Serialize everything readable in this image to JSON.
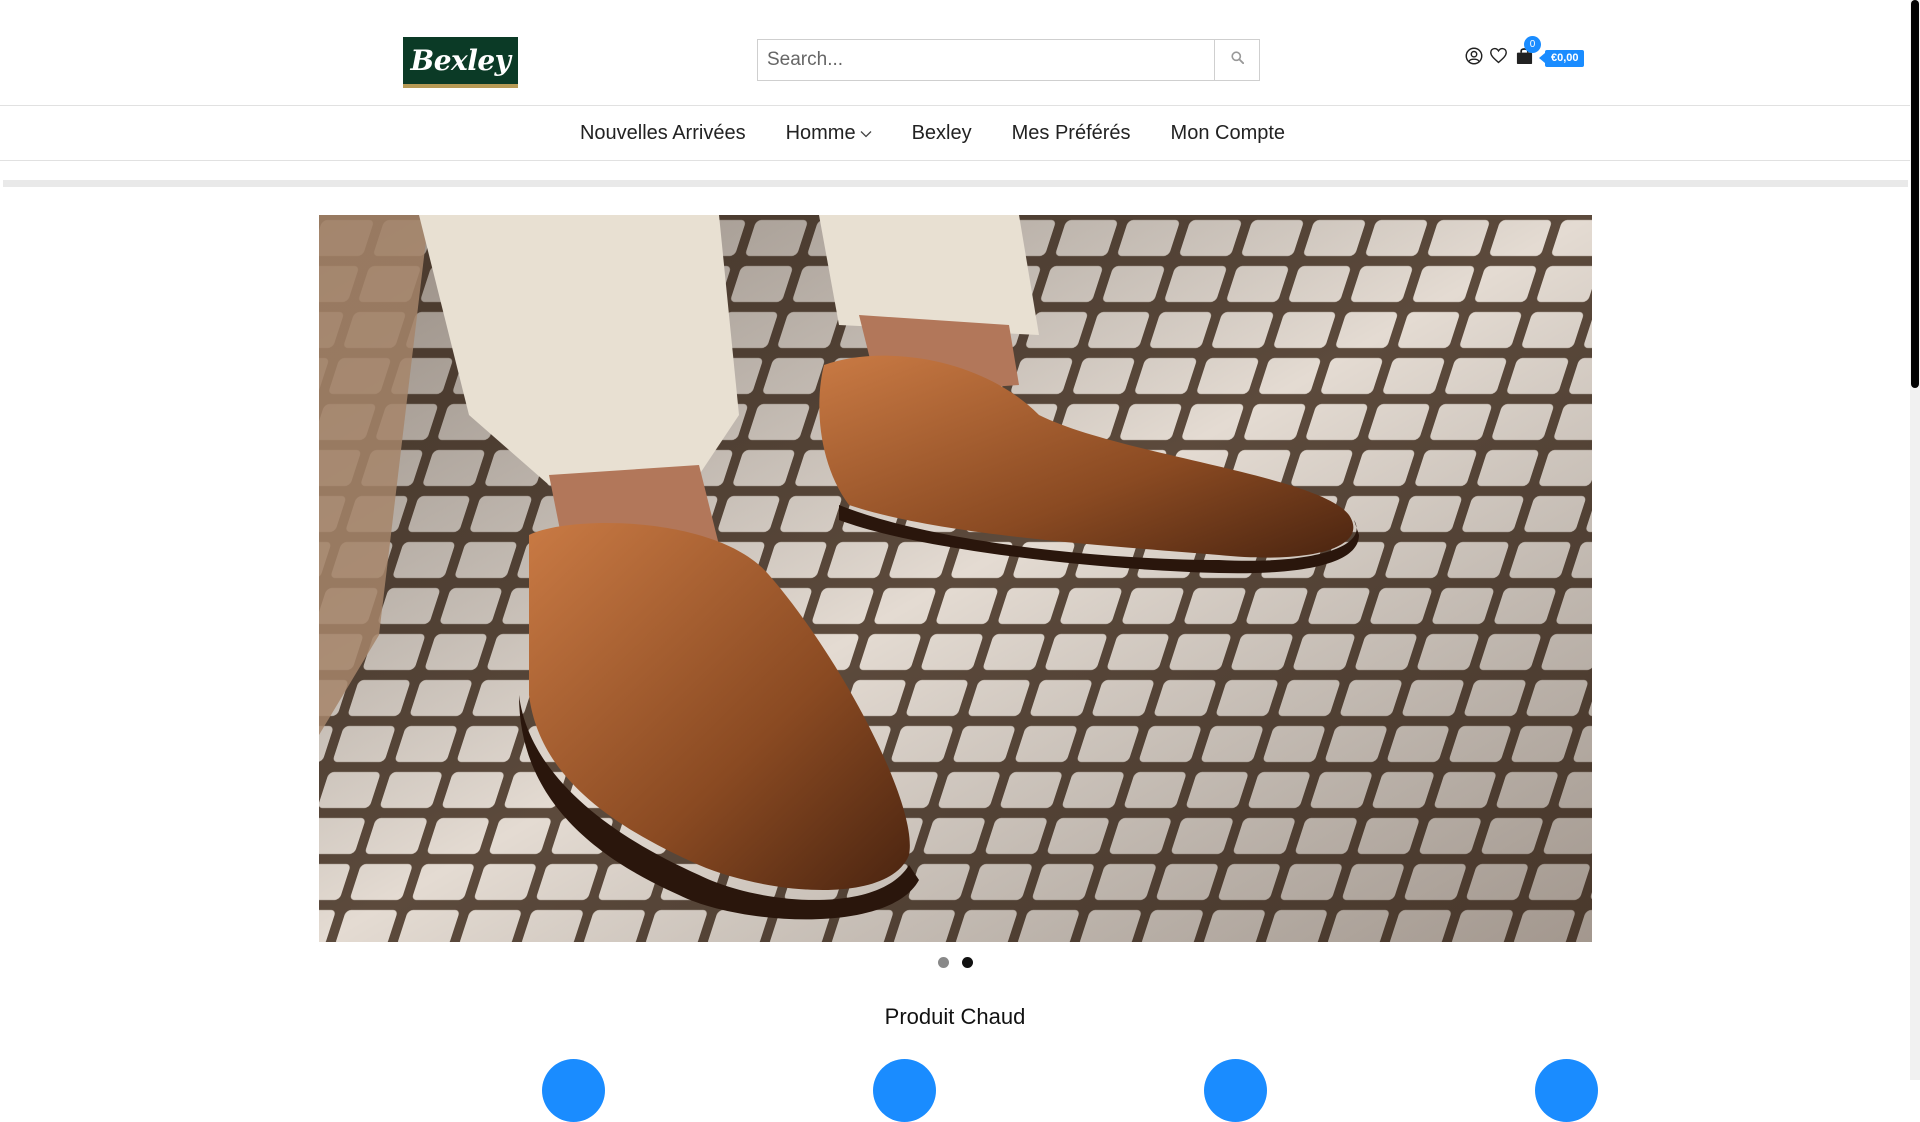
{
  "header": {
    "logo_text": "Bexley",
    "search_placeholder": "Search...",
    "cart_count": "0",
    "cart_total": "€0,00"
  },
  "nav": {
    "items": [
      {
        "label": "Nouvelles Arrivées"
      },
      {
        "label": "Homme"
      },
      {
        "label": "Bexley"
      },
      {
        "label": "Mes Préférés"
      },
      {
        "label": "Mon Compte"
      }
    ]
  },
  "hero": {
    "slides": 2,
    "active_slide": 2
  },
  "section": {
    "title": "Produit Chaud"
  },
  "colors": {
    "accent": "#1a8cff",
    "logo_bg": "#0b3a26",
    "logo_underline": "#b79a55"
  },
  "icons": [
    "search-icon",
    "user-icon",
    "heart-icon",
    "shopping-bag-icon",
    "chevron-down-icon"
  ]
}
